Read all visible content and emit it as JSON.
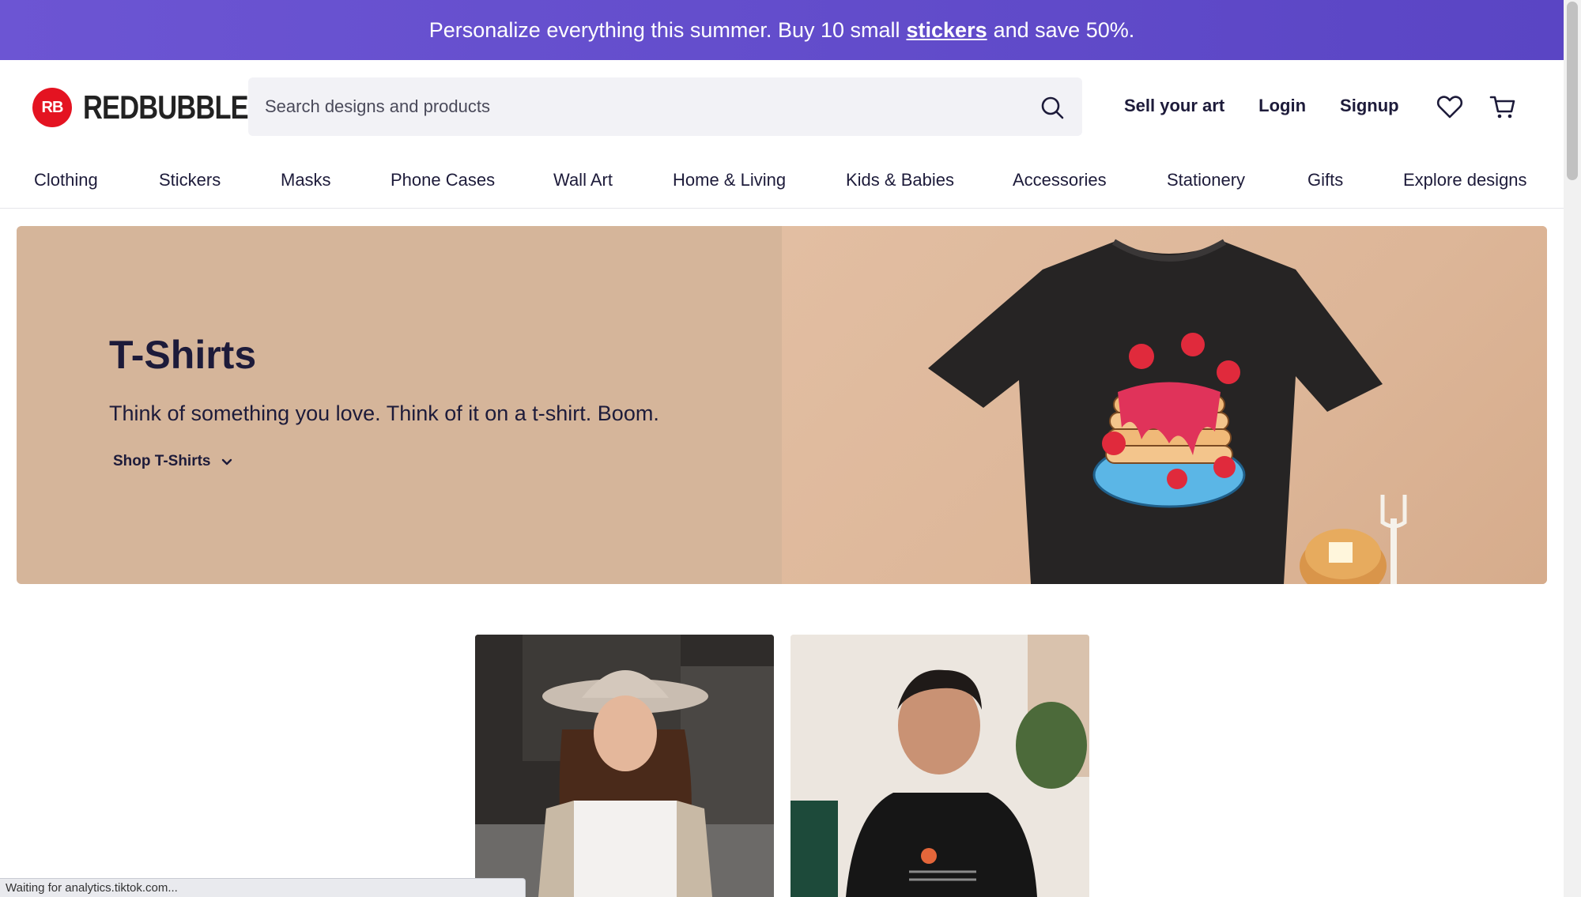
{
  "promo": {
    "text_before": "Personalize everything this summer. Buy 10 small",
    "link": "stickers",
    "text_after": "and save 50%."
  },
  "header": {
    "logo_badge": "RB",
    "logo_text": "REDBUBBLE",
    "search_placeholder": "Search designs and products",
    "actions": {
      "sell": "Sell your art",
      "login": "Login",
      "signup": "Signup"
    }
  },
  "categories": [
    "Clothing",
    "Stickers",
    "Masks",
    "Phone Cases",
    "Wall Art",
    "Home & Living",
    "Kids & Babies",
    "Accessories",
    "Stationery",
    "Gifts",
    "Explore designs"
  ],
  "hero": {
    "title": "T-Shirts",
    "subtitle": "Think of something you love. Think of it on a t-shirt. Boom.",
    "cta": "Shop T-Shirts"
  },
  "status": "Waiting for analytics.tiktok.com...",
  "colors": {
    "promo": "#6c55d3",
    "brand_red": "#e41321",
    "hero_bg": "#d5b59a",
    "text_dark": "#1d1b3a"
  }
}
